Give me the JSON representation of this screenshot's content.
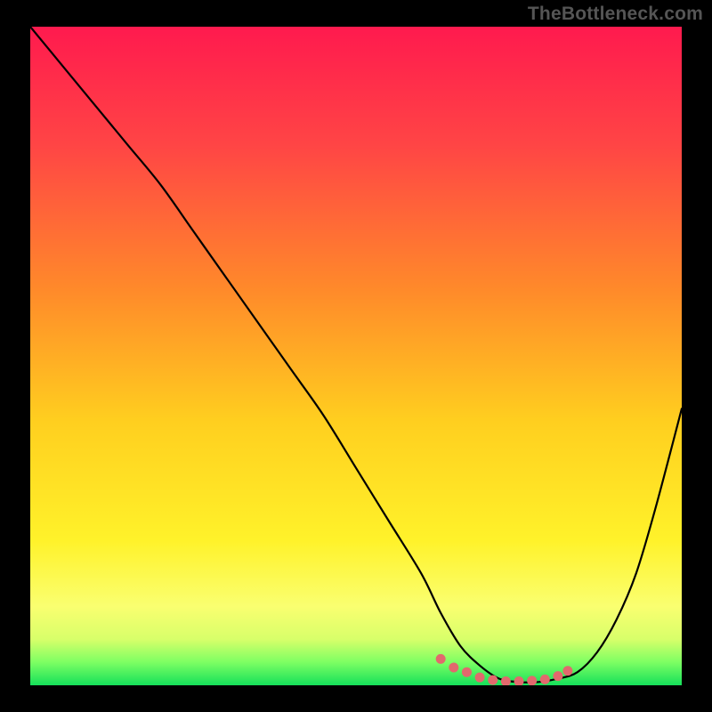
{
  "watermark": "TheBottleneck.com",
  "colors": {
    "background": "#000000",
    "gradient_stops": [
      {
        "offset": 0.0,
        "color": "#ff1a4e"
      },
      {
        "offset": 0.18,
        "color": "#ff4545"
      },
      {
        "offset": 0.4,
        "color": "#ff8a2a"
      },
      {
        "offset": 0.6,
        "color": "#ffcf1f"
      },
      {
        "offset": 0.78,
        "color": "#fff22a"
      },
      {
        "offset": 0.88,
        "color": "#faff70"
      },
      {
        "offset": 0.93,
        "color": "#d8ff6a"
      },
      {
        "offset": 0.965,
        "color": "#7dff63"
      },
      {
        "offset": 1.0,
        "color": "#15e05a"
      }
    ],
    "curve": "#000000",
    "marker": "#e2696d"
  },
  "chart_data": {
    "type": "line",
    "title": "",
    "xlabel": "",
    "ylabel": "",
    "xlim": [
      0,
      100
    ],
    "ylim": [
      0,
      100
    ],
    "grid": false,
    "series": [
      {
        "name": "bottleneck-curve",
        "x": [
          0,
          5,
          10,
          15,
          20,
          25,
          30,
          35,
          40,
          45,
          50,
          55,
          60,
          63,
          66,
          69,
          72,
          75,
          78,
          81,
          84,
          87,
          90,
          93,
          96,
          100
        ],
        "y": [
          100,
          94,
          88,
          82,
          76,
          69,
          62,
          55,
          48,
          41,
          33,
          25,
          17,
          11,
          6,
          3,
          1,
          0.5,
          0.5,
          1,
          2,
          5,
          10,
          17,
          27,
          42
        ]
      }
    ],
    "markers": {
      "name": "optimal-range",
      "x": [
        63,
        65,
        67,
        69,
        71,
        73,
        75,
        77,
        79,
        81,
        82.5
      ],
      "y": [
        4.0,
        2.7,
        2.0,
        1.2,
        0.8,
        0.6,
        0.6,
        0.7,
        0.9,
        1.4,
        2.2
      ]
    }
  }
}
